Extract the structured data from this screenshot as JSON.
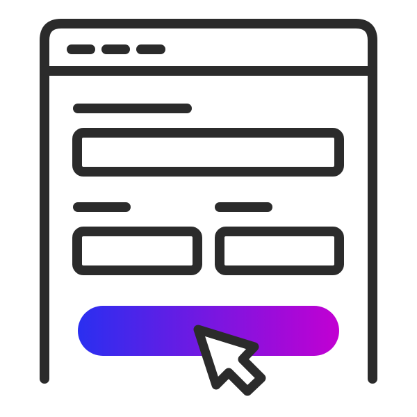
{
  "illustration": {
    "subject": "browser-window-form",
    "colors": {
      "stroke": "#2b2b2b",
      "background": "#ffffff",
      "gradient_start": "#2a2ff0",
      "gradient_end": "#c200d2"
    },
    "icons": {
      "window": "browser-window-icon",
      "cursor": "mouse-pointer-icon"
    }
  }
}
